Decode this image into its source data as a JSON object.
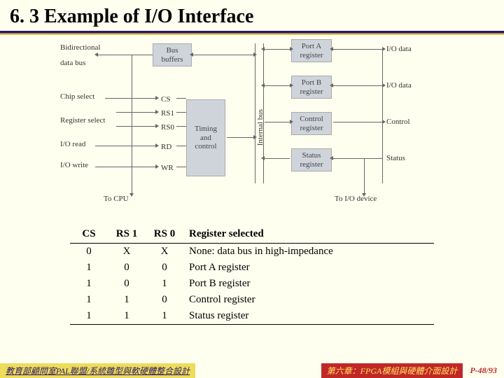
{
  "title": "6. 3 Example of I/O Interface",
  "diagram": {
    "left_labels": {
      "bidir": "Bidirectional",
      "databus": "data bus",
      "chipselect": "Chip select",
      "regselect": "Register select",
      "ioread": "I/O read",
      "iowrite": "I/O write",
      "tocpu": "To CPU"
    },
    "signals": {
      "cs": "CS",
      "rs1": "RS1",
      "rs0": "RS0",
      "rd": "RD",
      "wr": "WR"
    },
    "blocks": {
      "busbuffers_l1": "Bus",
      "busbuffers_l2": "buffers",
      "timing_l1": "Timing",
      "timing_l2": "and",
      "timing_l3": "control",
      "portA_l1": "Port A",
      "portA_l2": "register",
      "portB_l1": "Port B",
      "portB_l2": "register",
      "control_l1": "Control",
      "control_l2": "register",
      "status_l1": "Status",
      "status_l2": "register"
    },
    "right_labels": {
      "iodata1": "I/O data",
      "iodata2": "I/O data",
      "control": "Control",
      "status": "Status",
      "todev": "To I/O device"
    },
    "bus_label": "Internal bus"
  },
  "table": {
    "headers": {
      "cs": "CS",
      "rs1": "RS 1",
      "rs0": "RS 0",
      "reg": "Register selected"
    },
    "rows": [
      {
        "cs": "0",
        "rs1": "X",
        "rs0": "X",
        "reg": "None: data bus in high-impedance"
      },
      {
        "cs": "1",
        "rs1": "0",
        "rs0": "0",
        "reg": "Port A register"
      },
      {
        "cs": "1",
        "rs1": "0",
        "rs0": "1",
        "reg": "Port B register"
      },
      {
        "cs": "1",
        "rs1": "1",
        "rs0": "0",
        "reg": "Control register"
      },
      {
        "cs": "1",
        "rs1": "1",
        "rs0": "1",
        "reg": "Status register"
      }
    ]
  },
  "footer": {
    "left": "教育部顧問室PAL聯盟/系統雛型與軟硬體整合設計",
    "right": "第六章：FPGA模組與硬體介面設計",
    "page": "P-48/93"
  }
}
